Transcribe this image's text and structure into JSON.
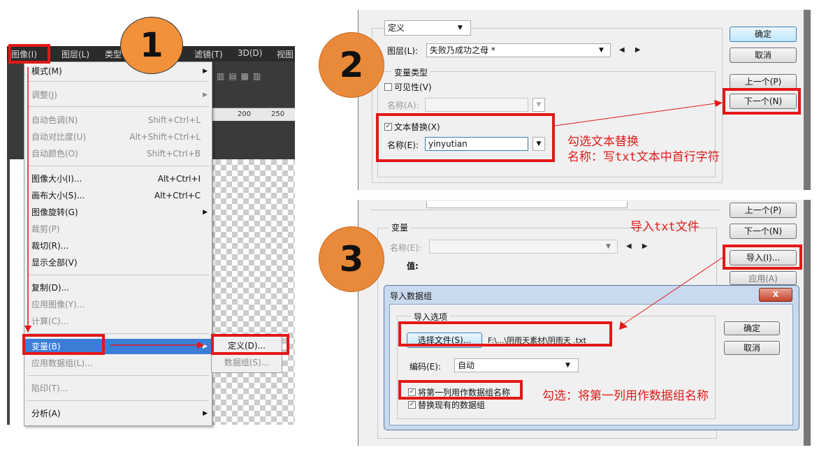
{
  "panel1": {
    "menubar": [
      "图像(I)",
      "图层(L)",
      "类型",
      ")",
      "滤镜(T)",
      "3D(D)",
      "视图"
    ],
    "ruler": [
      "200",
      "250"
    ],
    "menu_items": [
      {
        "label": "模式(M)",
        "shortcut": "",
        "submenu": true,
        "disabled": false
      },
      {
        "label": "调整(J)",
        "shortcut": "",
        "submenu": true,
        "disabled": true
      },
      {
        "label": "自动色调(N)",
        "shortcut": "Shift+Ctrl+L",
        "submenu": false,
        "disabled": true
      },
      {
        "label": "自动对比度(U)",
        "shortcut": "Alt+Shift+Ctrl+L",
        "submenu": false,
        "disabled": true
      },
      {
        "label": "自动颜色(O)",
        "shortcut": "Shift+Ctrl+B",
        "submenu": false,
        "disabled": true
      },
      {
        "label": "图像大小(I)...",
        "shortcut": "Alt+Ctrl+I",
        "submenu": false,
        "disabled": false
      },
      {
        "label": "画布大小(S)...",
        "shortcut": "Alt+Ctrl+C",
        "submenu": false,
        "disabled": false
      },
      {
        "label": "图像旋转(G)",
        "shortcut": "",
        "submenu": true,
        "disabled": false
      },
      {
        "label": "裁剪(P)",
        "shortcut": "",
        "submenu": false,
        "disabled": true
      },
      {
        "label": "裁切(R)...",
        "shortcut": "",
        "submenu": false,
        "disabled": false
      },
      {
        "label": "显示全部(V)",
        "shortcut": "",
        "submenu": false,
        "disabled": false
      },
      {
        "label": "复制(D)...",
        "shortcut": "",
        "submenu": false,
        "disabled": false
      },
      {
        "label": "应用图像(Y)...",
        "shortcut": "",
        "submenu": false,
        "disabled": true
      },
      {
        "label": "计算(C)...",
        "shortcut": "",
        "submenu": false,
        "disabled": true
      },
      {
        "label": "变量(B)",
        "shortcut": "",
        "submenu": true,
        "disabled": false,
        "selected": true
      },
      {
        "label": "应用数据组(L)...",
        "shortcut": "",
        "submenu": false,
        "disabled": true
      },
      {
        "label": "陷印(T)...",
        "shortcut": "",
        "submenu": false,
        "disabled": true
      },
      {
        "label": "分析(A)",
        "shortcut": "",
        "submenu": true,
        "disabled": false
      }
    ],
    "submenu_items": [
      "定义(D)...",
      "数据组(S)..."
    ]
  },
  "panel2": {
    "define_select": "定义",
    "layer_label": "图层(L):",
    "layer_value": "失败乃成功之母 *",
    "var_type_label": "变量类型",
    "visibility_label": "可见性(V)",
    "name_a_label": "名称(A):",
    "text_replace_label": "文本替换(X)",
    "name_e_label": "名称(E):",
    "name_e_value": "yinyutian",
    "buttons": [
      "确定",
      "取消",
      "上一个(P)",
      "下一个(N)"
    ],
    "hint1": "勾选文本替换",
    "hint2": "名称：写txt文本中首行字符"
  },
  "panel3": {
    "buttons_top": [
      "上一个(P)",
      "下一个(N)",
      "导入(I)...",
      "应用(A)"
    ],
    "group_label": "变量",
    "name_label": "名称(E):",
    "value_label": "值:",
    "hint_import": "导入txt文件",
    "import_dialog": {
      "title": "导入数据组",
      "options_label": "导入选项",
      "choose_file_button": "选择文件(S)...",
      "file_path": "F:\\...\\阴雨天素材\\阴雨天 .txt",
      "encoding_label": "编码(E):",
      "encoding_value": "自动",
      "check_first_column": "将第一列用作数据组名称",
      "check_replace": "替换现有的数据组",
      "ok_button": "确定",
      "cancel_button": "取消",
      "close_button": "X"
    },
    "hint_check": "勾选：将第一列用作数据组名称"
  },
  "badges": [
    "1",
    "2",
    "3"
  ],
  "colors": {
    "accent_red": "#e31818",
    "badge_orange": "#e9893a",
    "menu_selected": "#3b7ed8"
  }
}
